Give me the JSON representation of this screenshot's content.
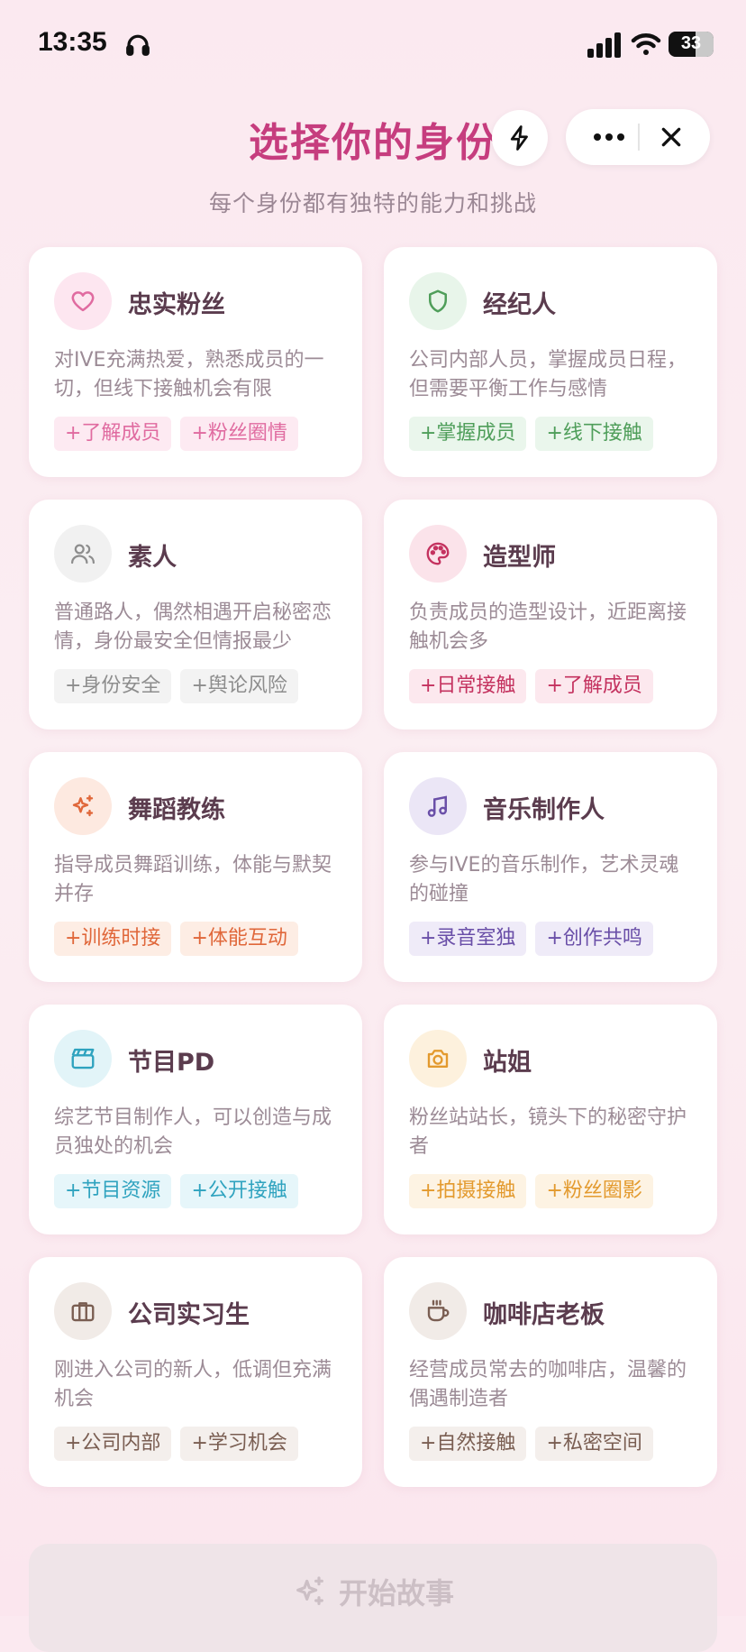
{
  "status_bar": {
    "time": "13:35",
    "battery": "33"
  },
  "header": {
    "title": "选择你的身份",
    "subtitle": "每个身份都有独特的能力和挑战"
  },
  "roles": [
    {
      "name": "忠实粉丝",
      "icon": "heart-icon",
      "desc": "对IVE充满热爱，熟悉成员的一切，但线下接触机会有限",
      "tags": [
        "+了解成员",
        "+粉丝圈情"
      ],
      "color": "#e06ba0",
      "tag_bg": "#fdeaf2",
      "icon_bg": "#fde6f0"
    },
    {
      "name": "经纪人",
      "icon": "shield-icon",
      "desc": "公司内部人员，掌握成员日程，但需要平衡工作与感情",
      "tags": [
        "+掌握成员",
        "+线下接触"
      ],
      "color": "#4f9e5a",
      "tag_bg": "#eaf6ec",
      "icon_bg": "#e8f5ea"
    },
    {
      "name": "素人",
      "icon": "users-icon",
      "desc": "普通路人，偶然相遇开启秘密恋情，身份最安全但情报最少",
      "tags": [
        "+身份安全",
        "+舆论风险"
      ],
      "color": "#8d8d8d",
      "tag_bg": "#f3f3f3",
      "icon_bg": "#f1f1f1"
    },
    {
      "name": "造型师",
      "icon": "palette-icon",
      "desc": "负责成员的造型设计，近距离接触机会多",
      "tags": [
        "+日常接触",
        "+了解成员"
      ],
      "color": "#c4325f",
      "tag_bg": "#fce8ee",
      "icon_bg": "#fbe3ea"
    },
    {
      "name": "舞蹈教练",
      "icon": "sparkle-icon",
      "desc": "指导成员舞蹈训练，体能与默契并存",
      "tags": [
        "+训练时接",
        "+体能互动"
      ],
      "color": "#e0673a",
      "tag_bg": "#fdede4",
      "icon_bg": "#fde9e0"
    },
    {
      "name": "音乐制作人",
      "icon": "music-note-icon",
      "desc": "参与IVE的音乐制作，艺术灵魂的碰撞",
      "tags": [
        "+录音室独",
        "+创作共鸣"
      ],
      "color": "#6a4fa8",
      "tag_bg": "#efebf8",
      "icon_bg": "#ebe6f6"
    },
    {
      "name": "节目PD",
      "icon": "clapperboard-icon",
      "desc": "综艺节目制作人，可以创造与成员独处的机会",
      "tags": [
        "+节目资源",
        "+公开接触"
      ],
      "color": "#2fa3bf",
      "tag_bg": "#e6f6fa",
      "icon_bg": "#e2f4f8"
    },
    {
      "name": "站姐",
      "icon": "camera-icon",
      "desc": "粉丝站站长，镜头下的秘密守护者",
      "tags": [
        "+拍摄接触",
        "+粉丝圈影"
      ],
      "color": "#e39a2e",
      "tag_bg": "#fdf3e3",
      "icon_bg": "#fdf1dd"
    },
    {
      "name": "公司实习生",
      "icon": "briefcase-icon",
      "desc": "刚进入公司的新人，低调但充满机会",
      "tags": [
        "+公司内部",
        "+学习机会"
      ],
      "color": "#7a5e52",
      "tag_bg": "#f4efec",
      "icon_bg": "#f1ebe7"
    },
    {
      "name": "咖啡店老板",
      "icon": "coffee-cup-icon",
      "desc": "经营成员常去的咖啡店，温馨的偶遇制造者",
      "tags": [
        "+自然接触",
        "+私密空间"
      ],
      "color": "#7a5e52",
      "tag_bg": "#f4efec",
      "icon_bg": "#f1ebe7"
    }
  ],
  "start_button": {
    "label": "开始故事"
  }
}
